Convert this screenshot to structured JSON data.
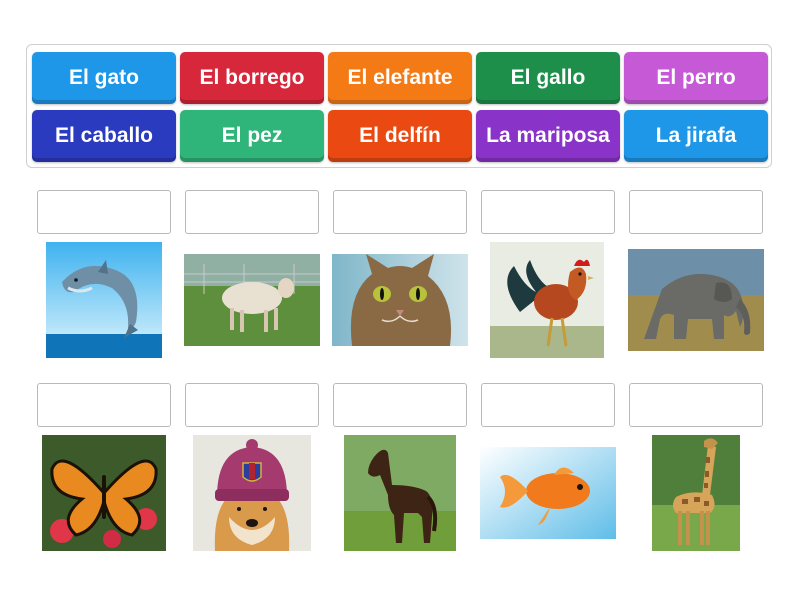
{
  "word_bank": [
    {
      "label": "El gato",
      "color": "#1f97e8"
    },
    {
      "label": "El borrego",
      "color": "#d7273a"
    },
    {
      "label": "El elefante",
      "color": "#f47a16"
    },
    {
      "label": "El gallo",
      "color": "#1e8f4b"
    },
    {
      "label": "El perro",
      "color": "#c659d6"
    },
    {
      "label": "El caballo",
      "color": "#2b3bbf"
    },
    {
      "label": "El pez",
      "color": "#2fb47a"
    },
    {
      "label": "El delfín",
      "color": "#ea4a12"
    },
    {
      "label": "La mariposa",
      "color": "#8a33c9"
    },
    {
      "label": "La jirafa",
      "color": "#1f97e8"
    }
  ],
  "images": [
    "dolphin-photo",
    "sheep-photo",
    "cat-photo",
    "rooster-photo",
    "elephant-photo",
    "butterfly-photo",
    "dog-photo",
    "horse-photo",
    "goldfish-photo",
    "giraffe-photo"
  ]
}
